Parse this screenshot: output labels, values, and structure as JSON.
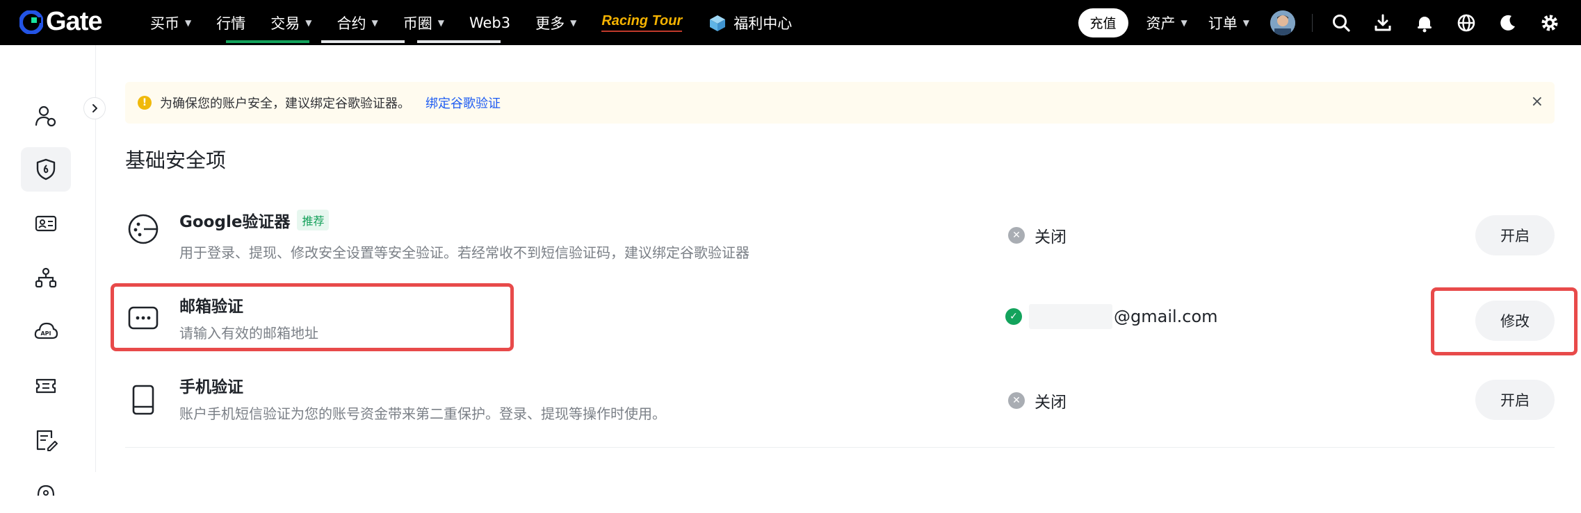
{
  "header": {
    "logo_text": "Gate",
    "nav": [
      {
        "label": "买币",
        "has_caret": true
      },
      {
        "label": "行情",
        "has_caret": false
      },
      {
        "label": "交易",
        "has_caret": true
      },
      {
        "label": "合约",
        "has_caret": true
      },
      {
        "label": "币圈",
        "has_caret": true
      },
      {
        "label": "Web3",
        "has_caret": false
      },
      {
        "label": "更多",
        "has_caret": true
      }
    ],
    "racing_label": "Racing Tour",
    "welfare_label": "福利中心",
    "deposit_label": "充值",
    "assets_label": "资产",
    "orders_label": "订单",
    "icons": [
      "avatar",
      "search-icon",
      "download-icon",
      "bell-icon",
      "globe-icon",
      "moon-icon",
      "gear-icon"
    ]
  },
  "sidebar": {
    "items": [
      {
        "icon": "user-icon",
        "active": false
      },
      {
        "icon": "shield-icon",
        "active": true
      },
      {
        "icon": "id-card-icon",
        "active": false
      },
      {
        "icon": "referral-icon",
        "active": false
      },
      {
        "icon": "api-icon",
        "active": false
      },
      {
        "icon": "coupon-icon",
        "active": false
      },
      {
        "icon": "edit-doc-icon",
        "active": false
      },
      {
        "icon": "more-icon",
        "active": false
      }
    ]
  },
  "alert": {
    "text": "为确保您的账户安全，建议绑定谷歌验证器。",
    "link": "绑定谷歌验证",
    "close": "×"
  },
  "security": {
    "section_title": "基础安全项",
    "items": [
      {
        "title": "Google验证器",
        "tag": "推荐",
        "desc": "用于登录、提现、修改安全设置等安全验证。若经常收不到短信验证码，建议绑定谷歌验证器",
        "status": "关闭",
        "action": "开启"
      },
      {
        "title": "邮箱验证",
        "desc": "请输入有效的邮箱地址",
        "status": "@gmail.com",
        "action": "修改"
      },
      {
        "title": "手机验证",
        "desc": "账户手机短信验证为您的账号资金带来第二重保护。登录、提现等操作时使用。",
        "status": "关闭",
        "action": "开启"
      }
    ]
  },
  "colors": {
    "accent_blue": "#1e5cf2",
    "success_green": "#13a35c",
    "highlight_red": "#e84a4a",
    "alert_bg": "#fffbef"
  }
}
